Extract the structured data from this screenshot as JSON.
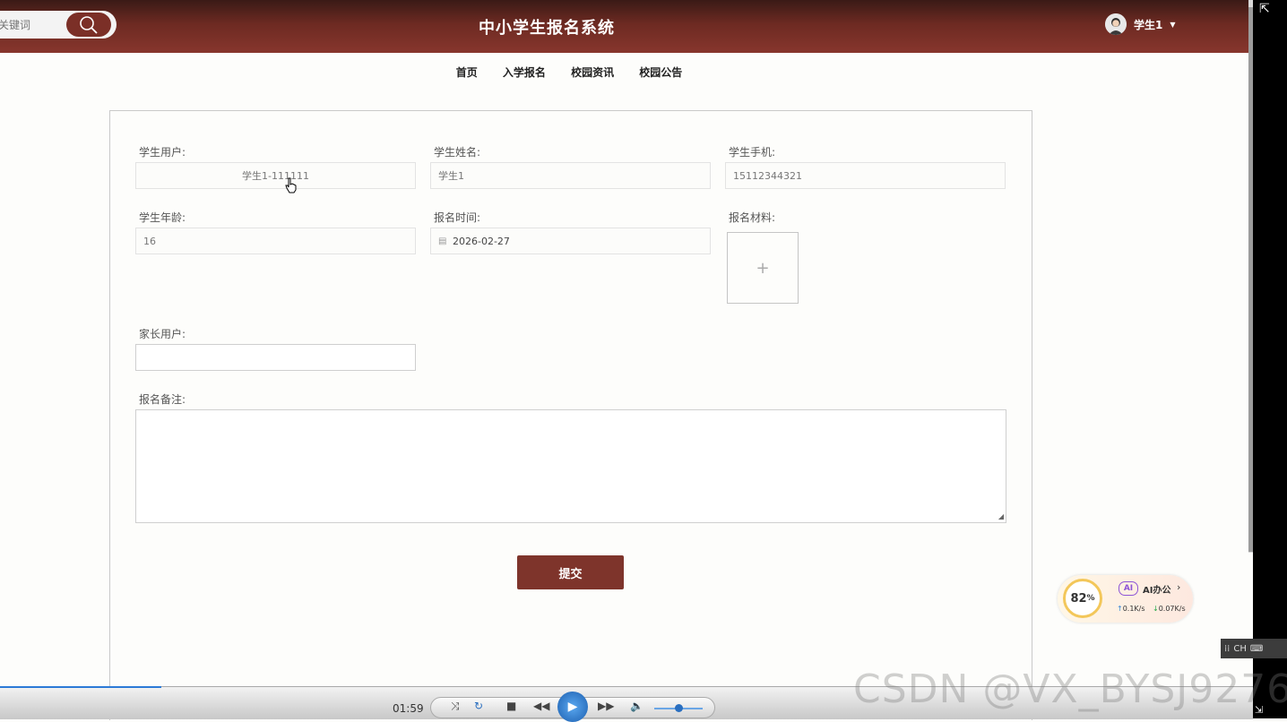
{
  "header": {
    "search_placeholder": "关键词",
    "title": "中小学生报名系统",
    "user_name": "学生1"
  },
  "nav": [
    "首页",
    "入学报名",
    "校园资讯",
    "校园公告"
  ],
  "form": {
    "student_user_label": "学生用户:",
    "student_user_value": "学生1-111111",
    "student_name_label": "学生姓名:",
    "student_name_value": "学生1",
    "student_phone_label": "学生手机:",
    "student_phone_value": "15112344321",
    "student_age_label": "学生年龄:",
    "student_age_value": "16",
    "signup_time_label": "报名时间:",
    "signup_time_value": "2026-02-27",
    "material_label": "报名材料:",
    "upload_plus": "+",
    "parent_user_label": "家长用户:",
    "parent_user_value": "",
    "remark_label": "报名备注:",
    "submit_label": "提交"
  },
  "widget": {
    "percent": "82",
    "percent_sign": "%",
    "ai_badge": "AI",
    "ai_label": "AI办公",
    "upload_speed": "0.1K/s",
    "download_speed": "0.07K/s"
  },
  "ime": {
    "lang": "CH"
  },
  "player": {
    "time": "01:59"
  },
  "watermark": "CSDN @VX_BYSJ9276"
}
